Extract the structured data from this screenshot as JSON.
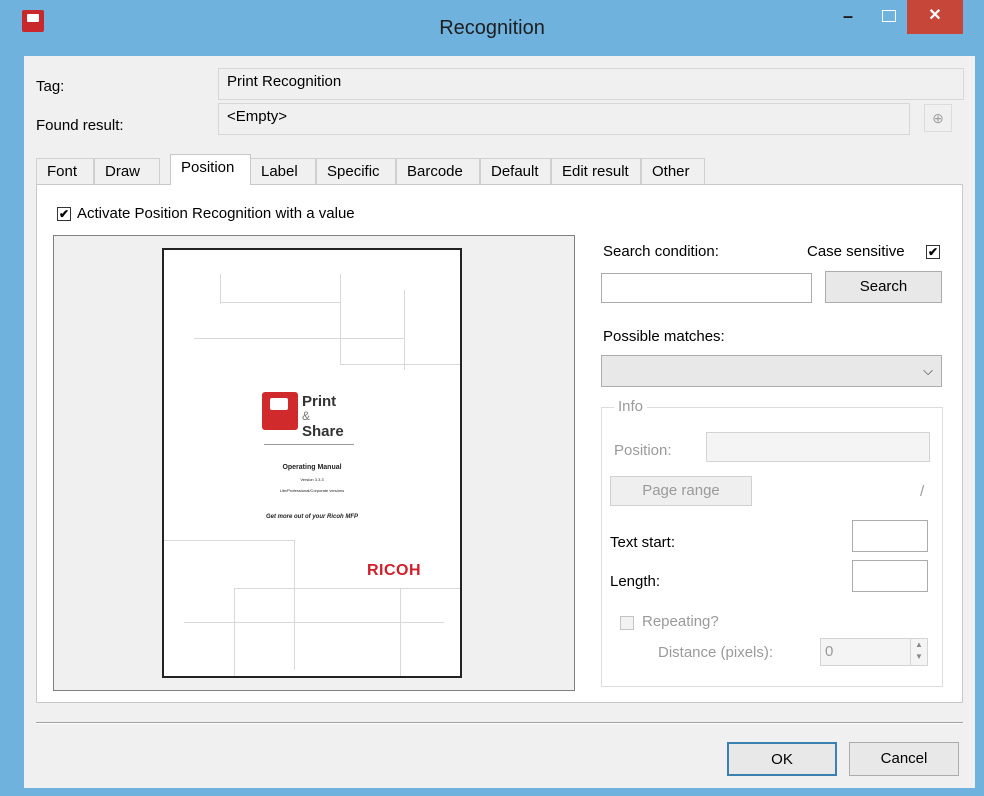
{
  "window": {
    "title": "Recognition",
    "min_glyph": "–",
    "close_glyph": "✕"
  },
  "header": {
    "tag_label": "Tag:",
    "tag_value": "Print Recognition",
    "found_label": "Found result:",
    "found_value": "<Empty>"
  },
  "tabs": [
    {
      "label": "Font"
    },
    {
      "label": "Draw"
    },
    {
      "label": "Position",
      "active": true
    },
    {
      "label": "Label"
    },
    {
      "label": "Specific"
    },
    {
      "label": "Barcode"
    },
    {
      "label": "Default"
    },
    {
      "label": "Edit result"
    },
    {
      "label": "Other"
    }
  ],
  "position": {
    "activate_label": "Activate Position Recognition with a value",
    "activate_checked": true,
    "search_condition_label": "Search condition:",
    "case_sensitive_label": "Case sensitive",
    "case_sensitive_checked": true,
    "search_value": "",
    "search_button": "Search",
    "possible_matches_label": "Possible matches:",
    "possible_matches_value": "",
    "info": {
      "title": "Info",
      "position_label": "Position:",
      "position_value": "",
      "page_range_button": "Page range",
      "page_range_sep": "/",
      "text_start_label": "Text start:",
      "text_start_value": "",
      "length_label": "Length:",
      "length_value": "",
      "repeating_label": "Repeating?",
      "repeating_checked": false,
      "distance_label": "Distance (pixels):",
      "distance_value": "0"
    }
  },
  "preview_doc": {
    "brand_top": "Print",
    "brand_amp": "&",
    "brand_bottom": "Share",
    "heading": "Operating Manual",
    "version": "Version 3.3.3",
    "editions": "Lite/Professional/Corporate versions",
    "tagline": "Get more out of your Ricoh MFP",
    "maker": "RICOH"
  },
  "footer": {
    "ok_label": "OK",
    "cancel_label": "Cancel"
  }
}
